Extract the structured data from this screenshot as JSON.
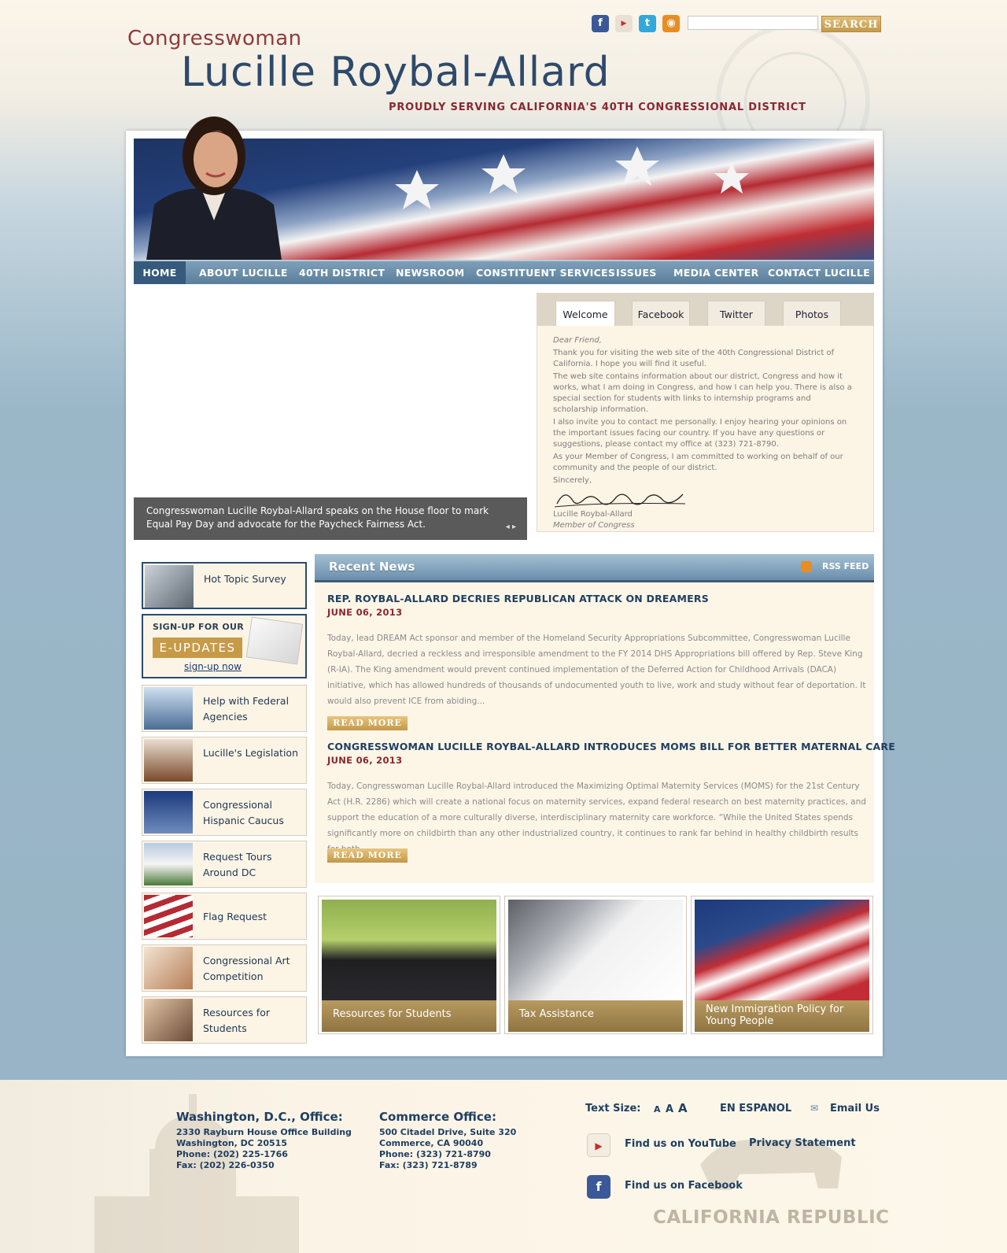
{
  "header": {
    "title_prefix": "Congresswoman",
    "name": "Lucille Roybal-Allard",
    "tagline": "PROUDLY SERVING CALIFORNIA'S 40TH CONGRESSIONAL DISTRICT",
    "search_button": "SEARCH",
    "search_value": "",
    "social_icons": [
      "facebook-icon",
      "youtube-icon",
      "twitter-icon",
      "rss-icon"
    ]
  },
  "nav": {
    "items": [
      "HOME",
      "ABOUT LUCILLE",
      "40TH DISTRICT",
      "NEWSROOM",
      "CONSTITUENT SERVICES",
      "ISSUES",
      "MEDIA CENTER",
      "CONTACT LUCILLE"
    ],
    "active": "HOME"
  },
  "video": {
    "caption": "Congresswoman Lucille Roybal-Allard speaks on the House floor to mark Equal Pay Day and advocate for the Paycheck Fairness Act."
  },
  "tabs": {
    "items": [
      "Welcome",
      "Facebook",
      "Twitter",
      "Photos"
    ],
    "active": "Welcome",
    "welcome": {
      "greeting": "Dear Friend,",
      "p1": "Thank you for visiting the web site of the 40th Congressional District of California. I hope you will find it useful.",
      "p2": "The web site contains information about our district, Congress and how it works, what I am doing in Congress, and how I can help you. There is also a special section for students with links to internship programs and scholarship information.",
      "p3": "I also invite you to contact me personally. I enjoy hearing your opinions on the important issues facing our country. If you have any questions or suggestions, please contact my office at (323) 721-8790.",
      "p4": "As your Member of Congress, I am committed to working on behalf of our community and the people of our district.",
      "closing": "Sincerely,",
      "sig_name": "Lucille Roybal-Allard",
      "sig_title": "Member of Congress"
    }
  },
  "sidebar": {
    "survey": "Hot Topic Survey",
    "eupdates": {
      "title": "SIGN-UP FOR OUR",
      "big": "E-UPDATES",
      "link": "sign-up now"
    },
    "items": [
      "Help with Federal Agencies",
      "Lucille's Legislation",
      "Congressional Hispanic Caucus",
      "Request Tours Around DC",
      "Flag Request",
      "Congressional Art Competition",
      "Resources for Students"
    ]
  },
  "news": {
    "heading": "Recent News",
    "rss_label": "RSS FEED",
    "read_more": "READ MORE",
    "articles": [
      {
        "title": "REP. ROYBAL-ALLARD DECRIES REPUBLICAN ATTACK ON DREAMERS",
        "date": "JUNE 06, 2013",
        "summary": "Today, lead DREAM Act sponsor and member of the Homeland Security Appropriations Subcommittee, Congresswoman Lucille Roybal-Allard, decried a reckless and irresponsible amendment to the FY 2014 DHS Appropriations bill offered by Rep. Steve King (R-IA). The King amendment would prevent continued implementation of the Deferred Action for Childhood Arrivals (DACA) initiative, which has allowed hundreds of thousands of undocumented youth to live, work and study without fear of deportation. It would also prevent ICE from abiding..."
      },
      {
        "title": "CONGRESSWOMAN LUCILLE ROYBAL-ALLARD INTRODUCES MOMS BILL FOR BETTER MATERNAL CARE",
        "date": "JUNE 06, 2013",
        "summary": "Today, Congresswoman Lucille Roybal-Allard introduced the Maximizing Optimal Maternity Services (MOMS) for the 21st Century Act (H.R. 2286) which will create a national focus on maternity services, expand federal research on best maternity practices, and support the education of a more culturally diverse, interdisciplinary maternity care workforce. “While the United States spends significantly more on childbirth than any other industrialized country, it continues to rank far behind in healthy childbirth results for both..."
      }
    ]
  },
  "features": [
    "Resources for Students",
    "Tax Assistance",
    "New Immigration Policy for Young People"
  ],
  "footer": {
    "dc_office": {
      "heading": "Washington, D.C., Office:",
      "lines": [
        "2330 Rayburn House Office Building",
        "Washington, DC 20515",
        "Phone: (202) 225-1766",
        "Fax: (202) 226-0350"
      ]
    },
    "commerce_office": {
      "heading": "Commerce Office:",
      "lines": [
        "500 Citadel Drive, Suite 320",
        "Commerce, CA 90040",
        "Phone: (323) 721-8790",
        "Fax: (323) 721-8789"
      ]
    },
    "text_size_label": "Text Size:",
    "text_size_options": [
      "A",
      "A",
      "A"
    ],
    "espanol": "EN ESPANOL",
    "email": "Email Us",
    "youtube": "Find us on YouTube",
    "privacy": "Privacy Statement",
    "facebook": "Find us on Facebook",
    "california_republic": "CALIFORNIA REPUBLIC"
  }
}
